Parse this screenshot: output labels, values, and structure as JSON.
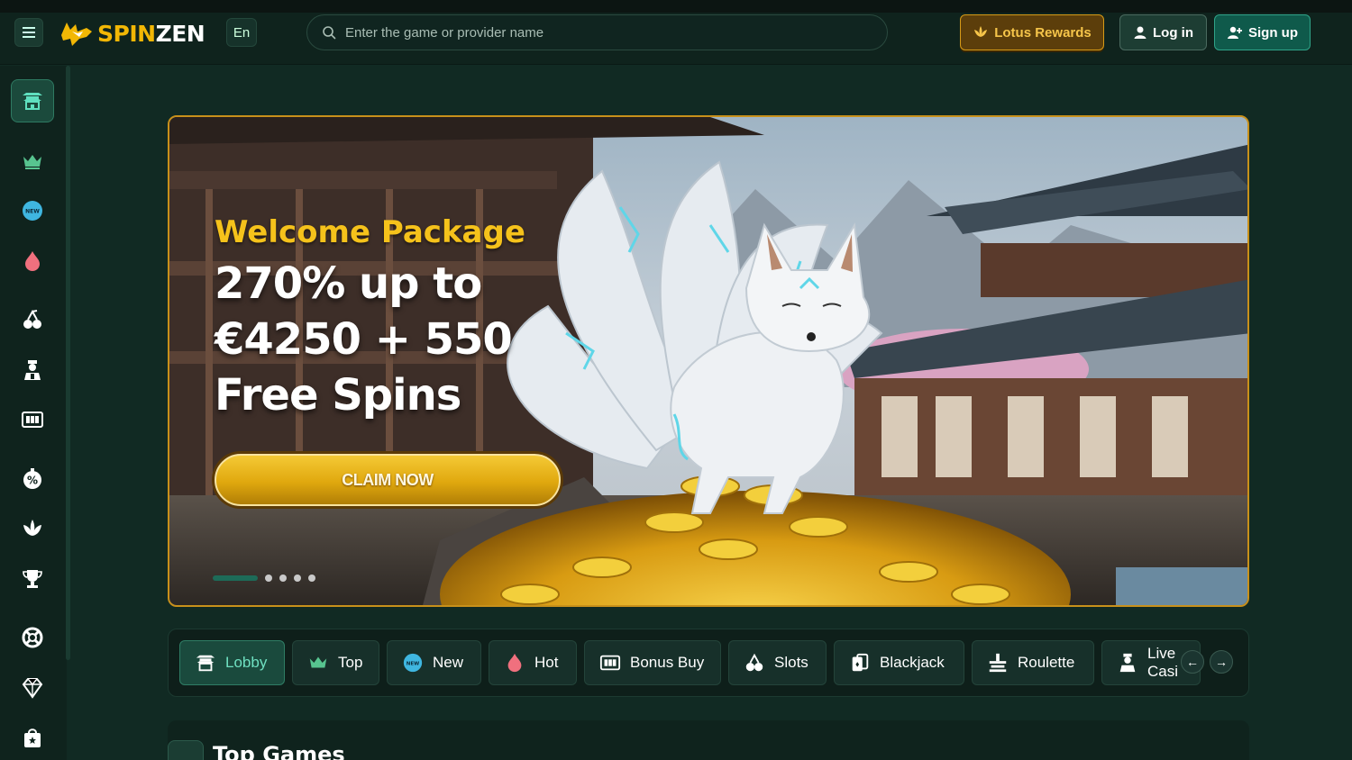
{
  "header": {
    "logo_spin": "SPIN",
    "logo_zen": "ZEN",
    "language": "En",
    "search_placeholder": "Enter the game or provider name",
    "rewards_label": "Lotus Rewards",
    "login_label": "Log in",
    "signup_label": "Sign up"
  },
  "sidebar": {
    "items": [
      {
        "icon": "pagoda-icon",
        "active": true
      },
      {
        "icon": "crown-icon"
      },
      {
        "icon": "new-badge-icon"
      },
      {
        "icon": "flame-icon"
      },
      {
        "icon": "cherries-icon"
      },
      {
        "icon": "dealer-icon"
      },
      {
        "icon": "bonus-buy-icon"
      },
      {
        "icon": "percent-icon"
      },
      {
        "icon": "lotus-icon"
      },
      {
        "icon": "trophy-icon"
      },
      {
        "icon": "lifebuoy-icon"
      },
      {
        "icon": "diamond-icon"
      },
      {
        "icon": "shop-bag-icon"
      }
    ]
  },
  "banner": {
    "title": "Welcome Package",
    "offer_line1": "270% up to",
    "offer_line2": "€4250 + 550",
    "offer_line3": "Free Spins",
    "cta": "CLAIM NOW",
    "slides_count": 5,
    "active_slide": 1
  },
  "categories": [
    {
      "label": "Lobby",
      "icon": "pagoda-icon",
      "active": true
    },
    {
      "label": "Top",
      "icon": "crown-icon"
    },
    {
      "label": "New",
      "icon": "new-badge-icon"
    },
    {
      "label": "Hot",
      "icon": "flame-icon"
    },
    {
      "label": "Bonus Buy",
      "icon": "bonus-buy-icon"
    },
    {
      "label": "Slots",
      "icon": "cherries-icon"
    },
    {
      "label": "Blackjack",
      "icon": "cards-icon"
    },
    {
      "label": "Roulette",
      "icon": "roulette-icon"
    },
    {
      "label": "Live Casi",
      "icon": "dealer-icon"
    }
  ],
  "section": {
    "title": "Top Games"
  },
  "colors": {
    "accent_gold": "#f5c21b",
    "accent_teal": "#2fa489",
    "bg": "#112a23"
  }
}
